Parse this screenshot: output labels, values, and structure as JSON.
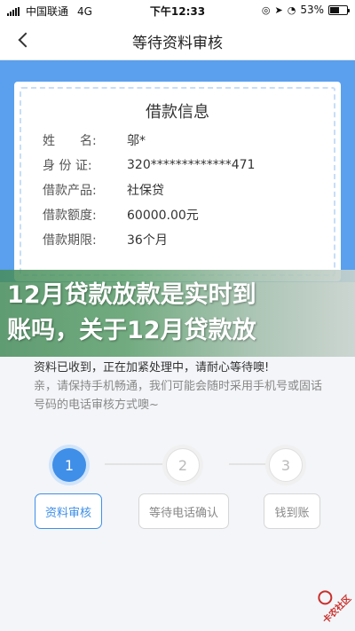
{
  "status_bar": {
    "carrier": "中国联通",
    "network": "4G",
    "time": "下午12:33",
    "battery": "53%",
    "battery_level": 0.53,
    "icons": [
      "signal-icon",
      "wifi-icon",
      "location-icon",
      "alarm-icon",
      "battery-icon"
    ]
  },
  "nav": {
    "title": "等待资料审核",
    "back_icon": "chevron-left-icon"
  },
  "colors": {
    "band": "#5aa0ee",
    "accent": "#3f8fe8"
  },
  "loan_info": {
    "title": "借款信息",
    "rows": [
      {
        "label": "姓　　名:",
        "value": "邬*"
      },
      {
        "label": "身 份 证:",
        "value": "320*************471"
      },
      {
        "label": "借款产品:",
        "value": "社保贷"
      },
      {
        "label": "借款额度:",
        "value": "60000.00元"
      },
      {
        "label": "借款期限:",
        "value": "36个月"
      }
    ]
  },
  "overlay": {
    "line1": "12月贷款放款是实时到",
    "line2": "账吗，关于12月贷款放"
  },
  "message": {
    "line1": "资料已收到，正在加紧处理中，请耐心等待噢!",
    "line2": "亲，请保持手机畅通，我们可能会随时采用手机号或固话号码的电话审核方式噢~"
  },
  "steps": [
    {
      "number": "1",
      "label": "资料审核",
      "active": true
    },
    {
      "number": "2",
      "label": "等待电话确认",
      "active": false
    },
    {
      "number": "3",
      "label": "钱到账",
      "active": false
    }
  ],
  "watermark": {
    "text": "卡农社区"
  }
}
